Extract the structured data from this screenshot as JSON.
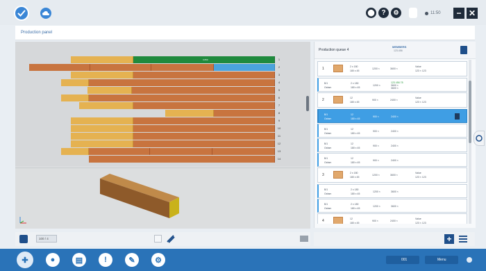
{
  "header": {
    "title": "Production panel",
    "time": "11:50",
    "icons": [
      "check-icon",
      "cloud-icon",
      "drop-icon",
      "help-icon",
      "settings-icon",
      "user-icon",
      "status-dot-icon",
      "minimize-icon",
      "close-icon"
    ]
  },
  "stack": {
    "row_numbers": [
      "1",
      "2",
      "3",
      "4",
      "5",
      "6",
      "7",
      "8",
      "9",
      "10",
      "11",
      "12",
      "13",
      "14"
    ],
    "cut_label": "3.650"
  },
  "left_bottom": {
    "zoom_label": "100 / 4"
  },
  "right_panel": {
    "title": "Production queue 4",
    "header_link": "MEMBERS",
    "header_sub": "123.456",
    "items": [
      {
        "num": "1",
        "text1": "2 x 180",
        "text2": "180 x 45",
        "text3": "1200 ×",
        "text4": "3600 ×",
        "text5": "Value",
        "text6": "123 ×   123"
      },
      {
        "num": "",
        "text1": "B/1",
        "text2": "Gelam",
        "text3": "2 x 180",
        "text4": "180 x 45",
        "text5": "1200 ×",
        "text6": "3600 ×",
        "green": "123 456 78",
        "note": "3600 ×"
      },
      {
        "num": "2",
        "text1": "12",
        "text2": "180 x 45",
        "text3": "900 ×",
        "text4": "2400 ×",
        "text5": "Value",
        "text6": "123 ×   123"
      },
      {
        "num": "",
        "text1": "B/1",
        "text2": "Gelam",
        "text3": "12",
        "text4": "180 x 45",
        "text5": "900 ×",
        "text6": "2400 ×"
      },
      {
        "num": "",
        "text1": "B/1",
        "text2": "Gelam",
        "text3": "12",
        "text4": "180 x 45",
        "text5": "900 ×",
        "text6": "2400 ×"
      },
      {
        "num": "",
        "text1": "B/1",
        "text2": "Gelam",
        "text3": "12",
        "text4": "180 x 45",
        "text5": "900 ×",
        "text6": "2400 ×"
      },
      {
        "num": "",
        "text1": "B/1",
        "text2": "Gelam",
        "text3": "12",
        "text4": "180 x 45",
        "text5": "900 ×",
        "text6": "2400 ×"
      },
      {
        "num": "3",
        "text1": "2 x 180",
        "text2": "180 x 45",
        "text3": "1200 ×",
        "text4": "3600 ×",
        "text5": "Value",
        "text6": "123 ×   123"
      },
      {
        "num": "",
        "text1": "B/1",
        "text2": "Gelam",
        "text3": "2 x 180",
        "text4": "180 x 45",
        "text5": "1200 ×",
        "text6": "3600 ×"
      },
      {
        "num": "",
        "text1": "B/1",
        "text2": "Gelam",
        "text3": "2 x 180",
        "text4": "180 x 45",
        "text5": "1200 ×",
        "text6": "3600 ×"
      },
      {
        "num": "4",
        "text1": "12",
        "text2": "180 x 45",
        "text3": "900 ×",
        "text4": "2400 ×",
        "text5": "Value",
        "text6": "123 ×   123"
      }
    ]
  },
  "taskbar": {
    "left_icons": [
      "menu-icon",
      "user-icon",
      "chart-icon",
      "alert-icon",
      "tools-icon",
      "settings-icon"
    ],
    "right_label_1": "001",
    "right_label_2": "Menu"
  },
  "colors": {
    "accent": "#3f9ee4",
    "taskbar": "#2a73b8",
    "board_orange": "#c8743f",
    "board_yellow": "#e5b251",
    "board_green": "#1f8a3d",
    "board_blue": "#4aa3dc"
  }
}
